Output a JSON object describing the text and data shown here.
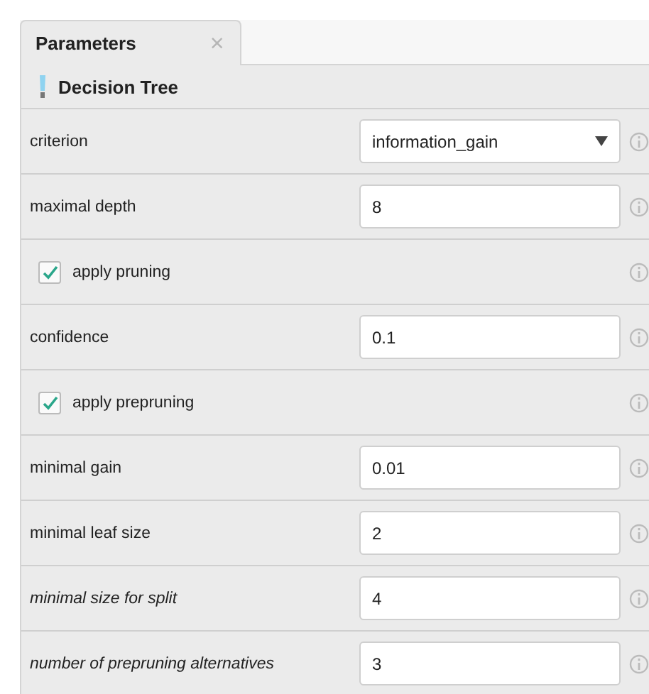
{
  "tabs": [
    {
      "label": "Parameters",
      "selected": true,
      "close": "×"
    }
  ],
  "operator": {
    "title": "Decision Tree"
  },
  "parameters": [
    {
      "kind": "select",
      "label": "criterion",
      "value": "information_gain",
      "italic": false
    },
    {
      "kind": "number",
      "label": "maximal depth",
      "value": "8",
      "italic": false
    },
    {
      "kind": "checkbox",
      "label": "apply pruning",
      "checked": true,
      "italic": false
    },
    {
      "kind": "number",
      "label": "confidence",
      "value": "0.1",
      "italic": false
    },
    {
      "kind": "checkbox",
      "label": "apply prepruning",
      "checked": true,
      "italic": false
    },
    {
      "kind": "number",
      "label": "minimal gain",
      "value": "0.01",
      "italic": false
    },
    {
      "kind": "number",
      "label": "minimal leaf size",
      "value": "2",
      "italic": false
    },
    {
      "kind": "number",
      "label": "minimal size for split",
      "value": "4",
      "italic": true
    },
    {
      "kind": "number",
      "label": "number of prepruning alternatives",
      "value": "3",
      "italic": true
    }
  ]
}
